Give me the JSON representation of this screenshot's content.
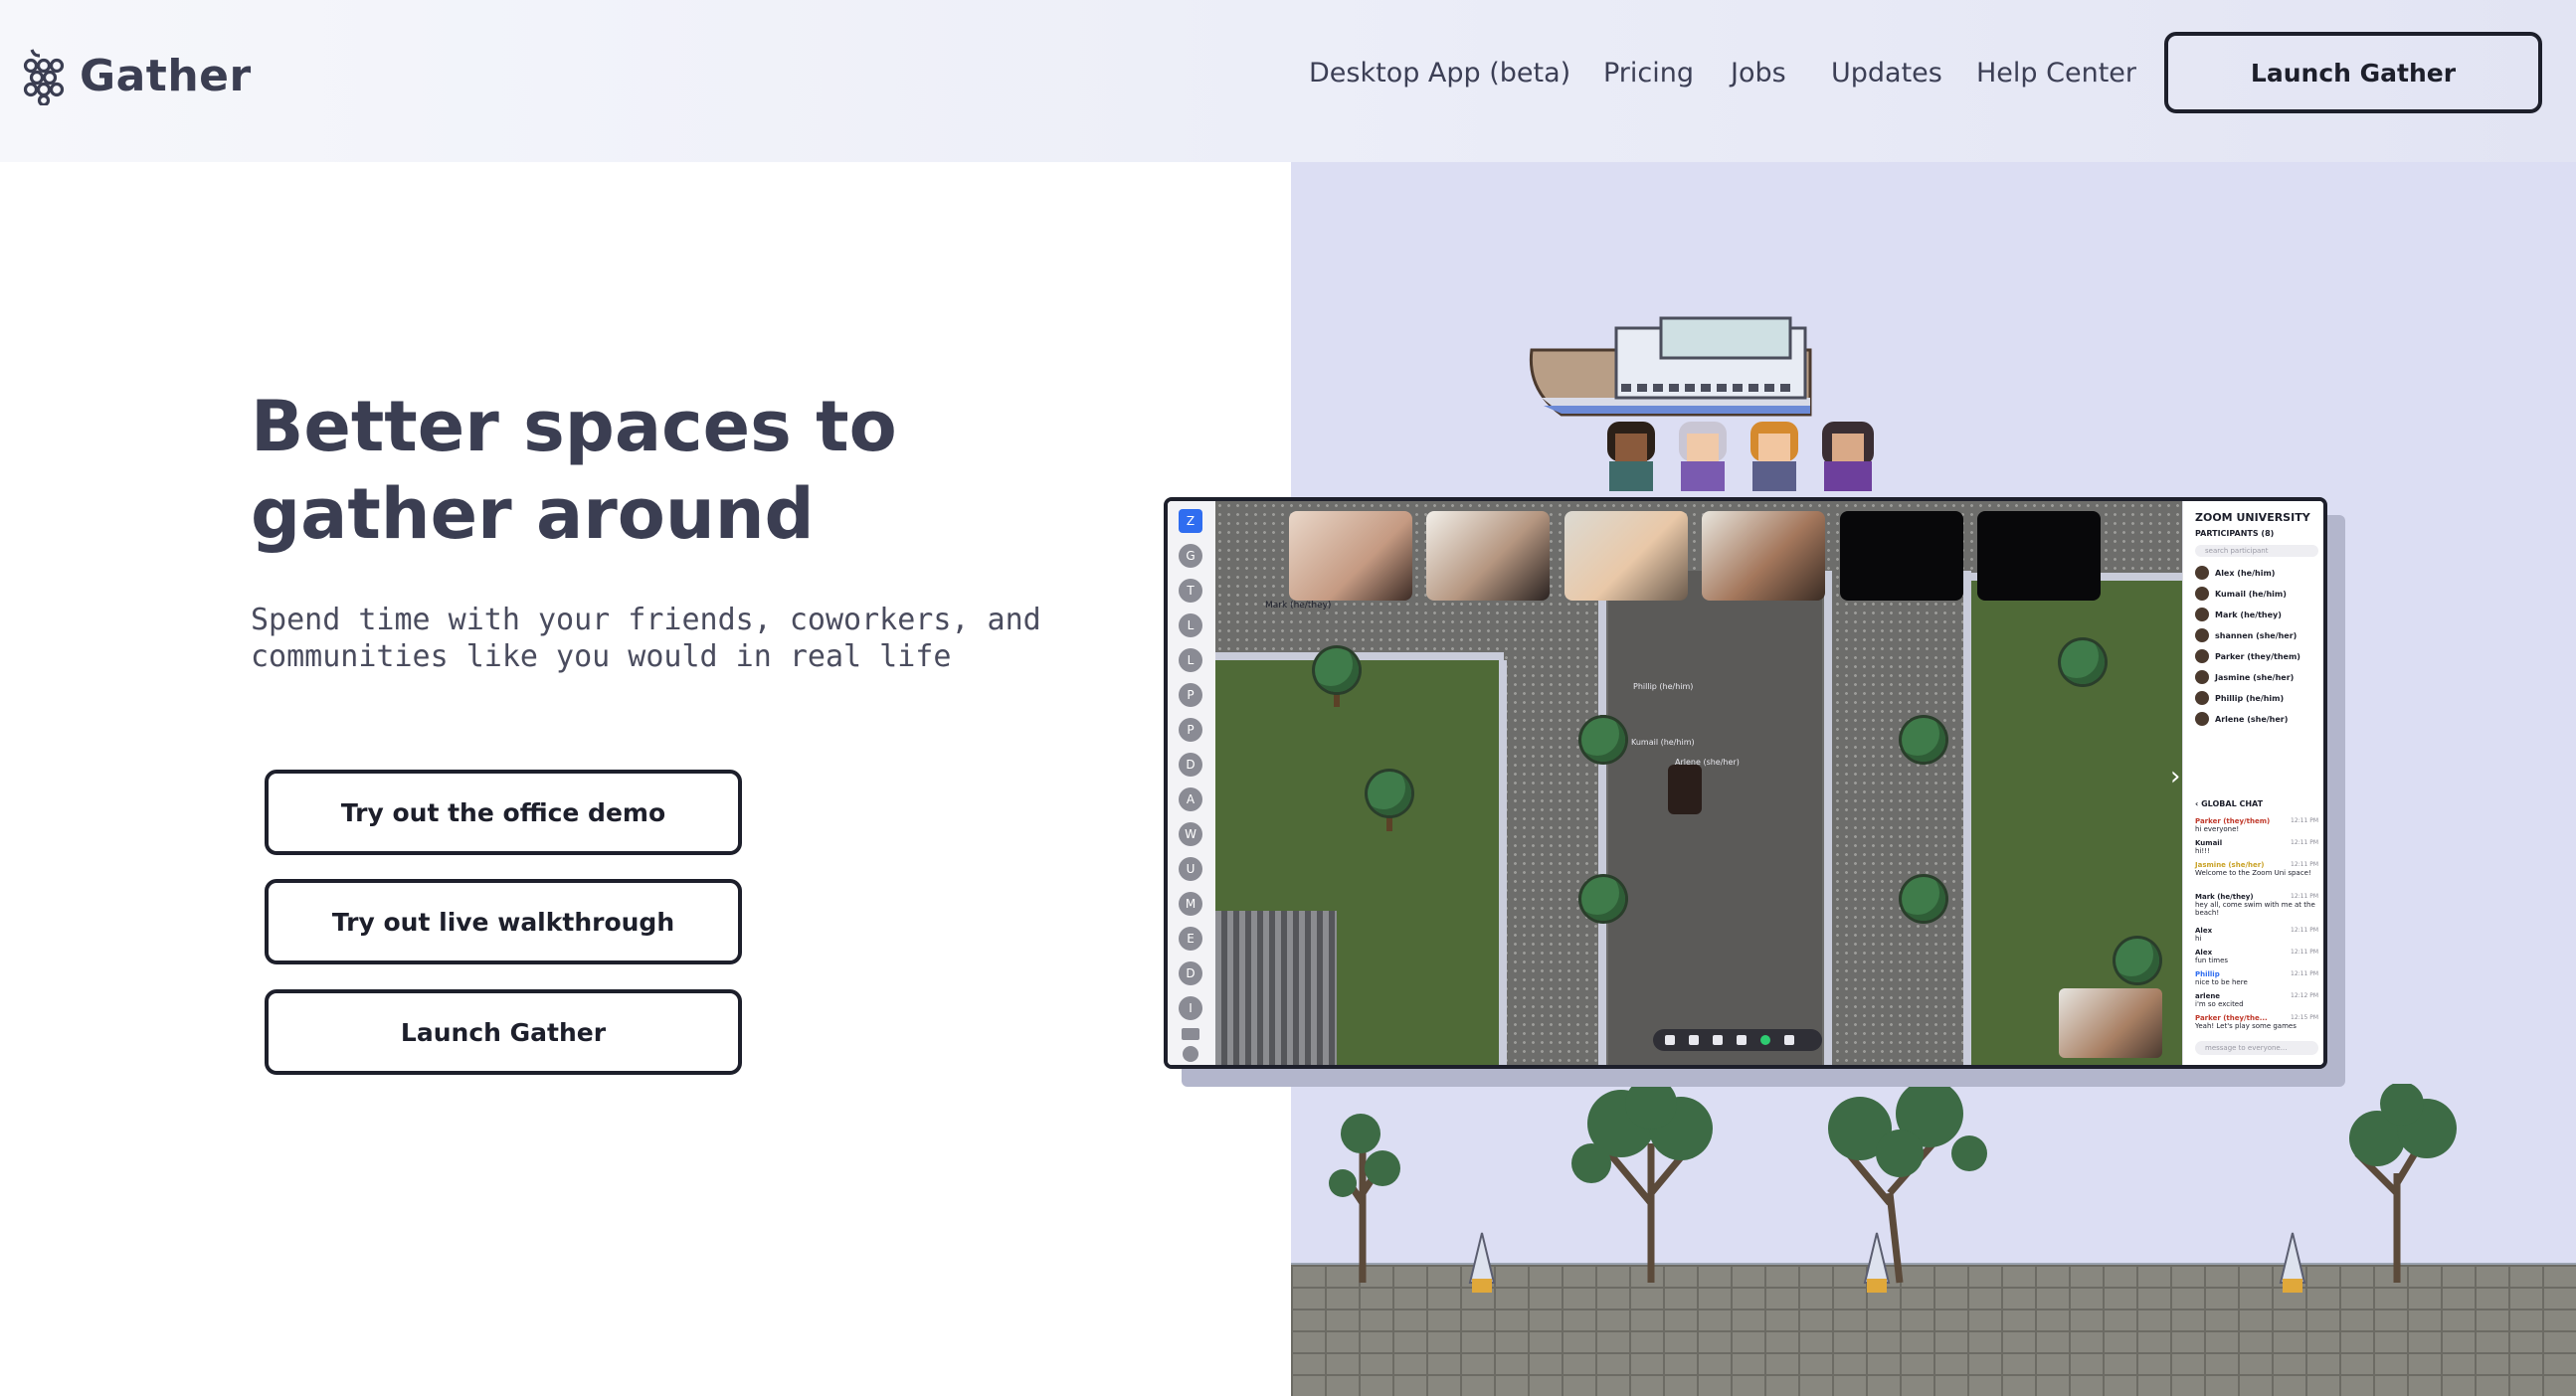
{
  "brand": {
    "name": "Gather",
    "logo_icon": "grapes-icon"
  },
  "nav": {
    "items": [
      "Desktop App (beta)",
      "Pricing",
      "Jobs",
      "Updates",
      "Help Center"
    ],
    "launch_label": "Launch Gather"
  },
  "hero": {
    "title_line1": "Better spaces to",
    "title_line2": "gather around",
    "subtitle_line1": "Spend time with your friends, coworkers, and",
    "subtitle_line2": "communities like you would in real life",
    "buttons": [
      "Try out the office demo",
      "Try out live walkthrough",
      "Launch Gather"
    ]
  },
  "app_screenshot": {
    "sidebar_letters": [
      "Z",
      "G",
      "T",
      "L",
      "L",
      "P",
      "P",
      "D",
      "A",
      "W",
      "U",
      "M",
      "E",
      "D",
      "I"
    ],
    "panel_title": "ZOOM UNIVERSITY",
    "participants_label": "PARTICIPANTS (8)",
    "search_placeholder": "search participant",
    "participants": [
      "Alex (he/him)",
      "Kumail (he/him)",
      "Mark (he/they)",
      "shannen (she/her)",
      "Parker (they/them)",
      "Jasmine (she/her)",
      "Phillip (he/him)",
      "Arlene (she/her)"
    ],
    "chat_title": "GLOBAL CHAT",
    "chat": [
      {
        "name": "Parker (they/them)",
        "text": "hi everyone!",
        "time": "12:11 PM",
        "color": "#c0392b"
      },
      {
        "name": "Kumail",
        "text": "hi!!!",
        "time": "12:11 PM",
        "color": "#1d1f2b"
      },
      {
        "name": "Jasmine (she/her)",
        "text": "Welcome to the Zoom Uni space!",
        "time": "12:11 PM",
        "color": "#c9a227"
      },
      {
        "name": "Mark (he/they)",
        "text": "hey all, come swim with me at the beach!",
        "time": "12:11 PM",
        "color": "#1d1f2b"
      },
      {
        "name": "Alex",
        "text": "hi",
        "time": "12:11 PM",
        "color": "#1d1f2b"
      },
      {
        "name": "Alex",
        "text": "fun times",
        "time": "12:11 PM",
        "color": "#1d1f2b"
      },
      {
        "name": "Phillip",
        "text": "nice to be here",
        "time": "12:11 PM",
        "color": "#2f6df0"
      },
      {
        "name": "arlene",
        "text": "i'm so excited",
        "time": "12:12 PM",
        "color": "#1d1f2b"
      },
      {
        "name": "Parker (they/the...",
        "text": "Yeah! Let's play some games",
        "time": "12:15 PM",
        "color": "#c0392b"
      }
    ],
    "chat_placeholder": "message to everyone...",
    "map_labels": [
      "Mark (he/they)",
      "Phillip (he/him)",
      "Kumail (he/him)",
      "Arlene (she/her)"
    ]
  },
  "colors": {
    "text_dark": "#3b3e52",
    "button_border": "#1d1f2b",
    "illustration_bg": "#dcdef3",
    "header_bg": "#eceef8"
  }
}
